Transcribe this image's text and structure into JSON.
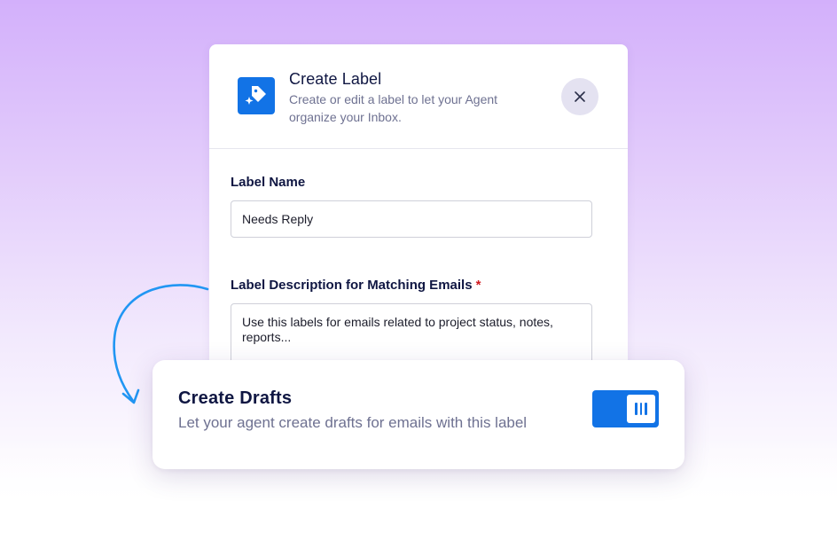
{
  "dialog": {
    "title": "Create Label",
    "subtitle": "Create or edit a label to let your Agent organize your Inbox.",
    "header_icon": "label-tag-icon",
    "close_icon": "close-icon",
    "label_name": {
      "label": "Label Name",
      "value": "Needs Reply"
    },
    "label_description": {
      "label": "Label Description for Matching Emails",
      "required_marker": "*",
      "value": "Use this labels for emails related to project status, notes, reports..."
    }
  },
  "drafts_card": {
    "title": "Create Drafts",
    "subtitle": "Let your agent create drafts for emails with this label",
    "toggle_on": true
  },
  "colors": {
    "accent": "#1273e6",
    "heading": "#0f1642",
    "muted": "#6e7191",
    "required": "#d0191f",
    "arrow": "#2196f3"
  }
}
